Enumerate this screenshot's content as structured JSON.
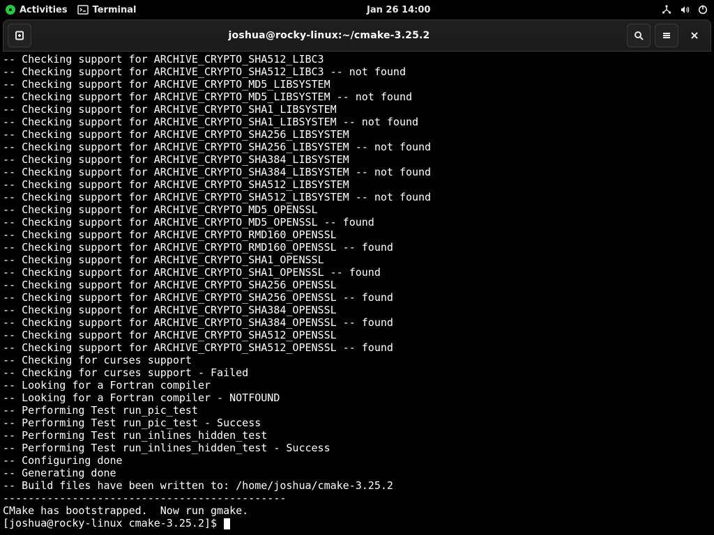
{
  "topbar": {
    "activities": "Activities",
    "app_label": "Terminal",
    "clock": "Jan 26  14:00"
  },
  "window": {
    "title": "joshua@rocky-linux:~/cmake-3.25.2"
  },
  "prompt": {
    "open": "[",
    "user": "joshua",
    "at": "@",
    "host": "rocky-linux",
    "path": "cmake-3.25.2",
    "close": "]$"
  },
  "terminal_lines": [
    "-- Checking support for ARCHIVE_CRYPTO_SHA512_LIBC3",
    "-- Checking support for ARCHIVE_CRYPTO_SHA512_LIBC3 -- not found",
    "-- Checking support for ARCHIVE_CRYPTO_MD5_LIBSYSTEM",
    "-- Checking support for ARCHIVE_CRYPTO_MD5_LIBSYSTEM -- not found",
    "-- Checking support for ARCHIVE_CRYPTO_SHA1_LIBSYSTEM",
    "-- Checking support for ARCHIVE_CRYPTO_SHA1_LIBSYSTEM -- not found",
    "-- Checking support for ARCHIVE_CRYPTO_SHA256_LIBSYSTEM",
    "-- Checking support for ARCHIVE_CRYPTO_SHA256_LIBSYSTEM -- not found",
    "-- Checking support for ARCHIVE_CRYPTO_SHA384_LIBSYSTEM",
    "-- Checking support for ARCHIVE_CRYPTO_SHA384_LIBSYSTEM -- not found",
    "-- Checking support for ARCHIVE_CRYPTO_SHA512_LIBSYSTEM",
    "-- Checking support for ARCHIVE_CRYPTO_SHA512_LIBSYSTEM -- not found",
    "-- Checking support for ARCHIVE_CRYPTO_MD5_OPENSSL",
    "-- Checking support for ARCHIVE_CRYPTO_MD5_OPENSSL -- found",
    "-- Checking support for ARCHIVE_CRYPTO_RMD160_OPENSSL",
    "-- Checking support for ARCHIVE_CRYPTO_RMD160_OPENSSL -- found",
    "-- Checking support for ARCHIVE_CRYPTO_SHA1_OPENSSL",
    "-- Checking support for ARCHIVE_CRYPTO_SHA1_OPENSSL -- found",
    "-- Checking support for ARCHIVE_CRYPTO_SHA256_OPENSSL",
    "-- Checking support for ARCHIVE_CRYPTO_SHA256_OPENSSL -- found",
    "-- Checking support for ARCHIVE_CRYPTO_SHA384_OPENSSL",
    "-- Checking support for ARCHIVE_CRYPTO_SHA384_OPENSSL -- found",
    "-- Checking support for ARCHIVE_CRYPTO_SHA512_OPENSSL",
    "-- Checking support for ARCHIVE_CRYPTO_SHA512_OPENSSL -- found",
    "-- Checking for curses support",
    "-- Checking for curses support - Failed",
    "-- Looking for a Fortran compiler",
    "-- Looking for a Fortran compiler - NOTFOUND",
    "-- Performing Test run_pic_test",
    "-- Performing Test run_pic_test - Success",
    "-- Performing Test run_inlines_hidden_test",
    "-- Performing Test run_inlines_hidden_test - Success",
    "-- Configuring done",
    "-- Generating done",
    "-- Build files have been written to: /home/joshua/cmake-3.25.2",
    "---------------------------------------------",
    "CMake has bootstrapped.  Now run gmake."
  ]
}
